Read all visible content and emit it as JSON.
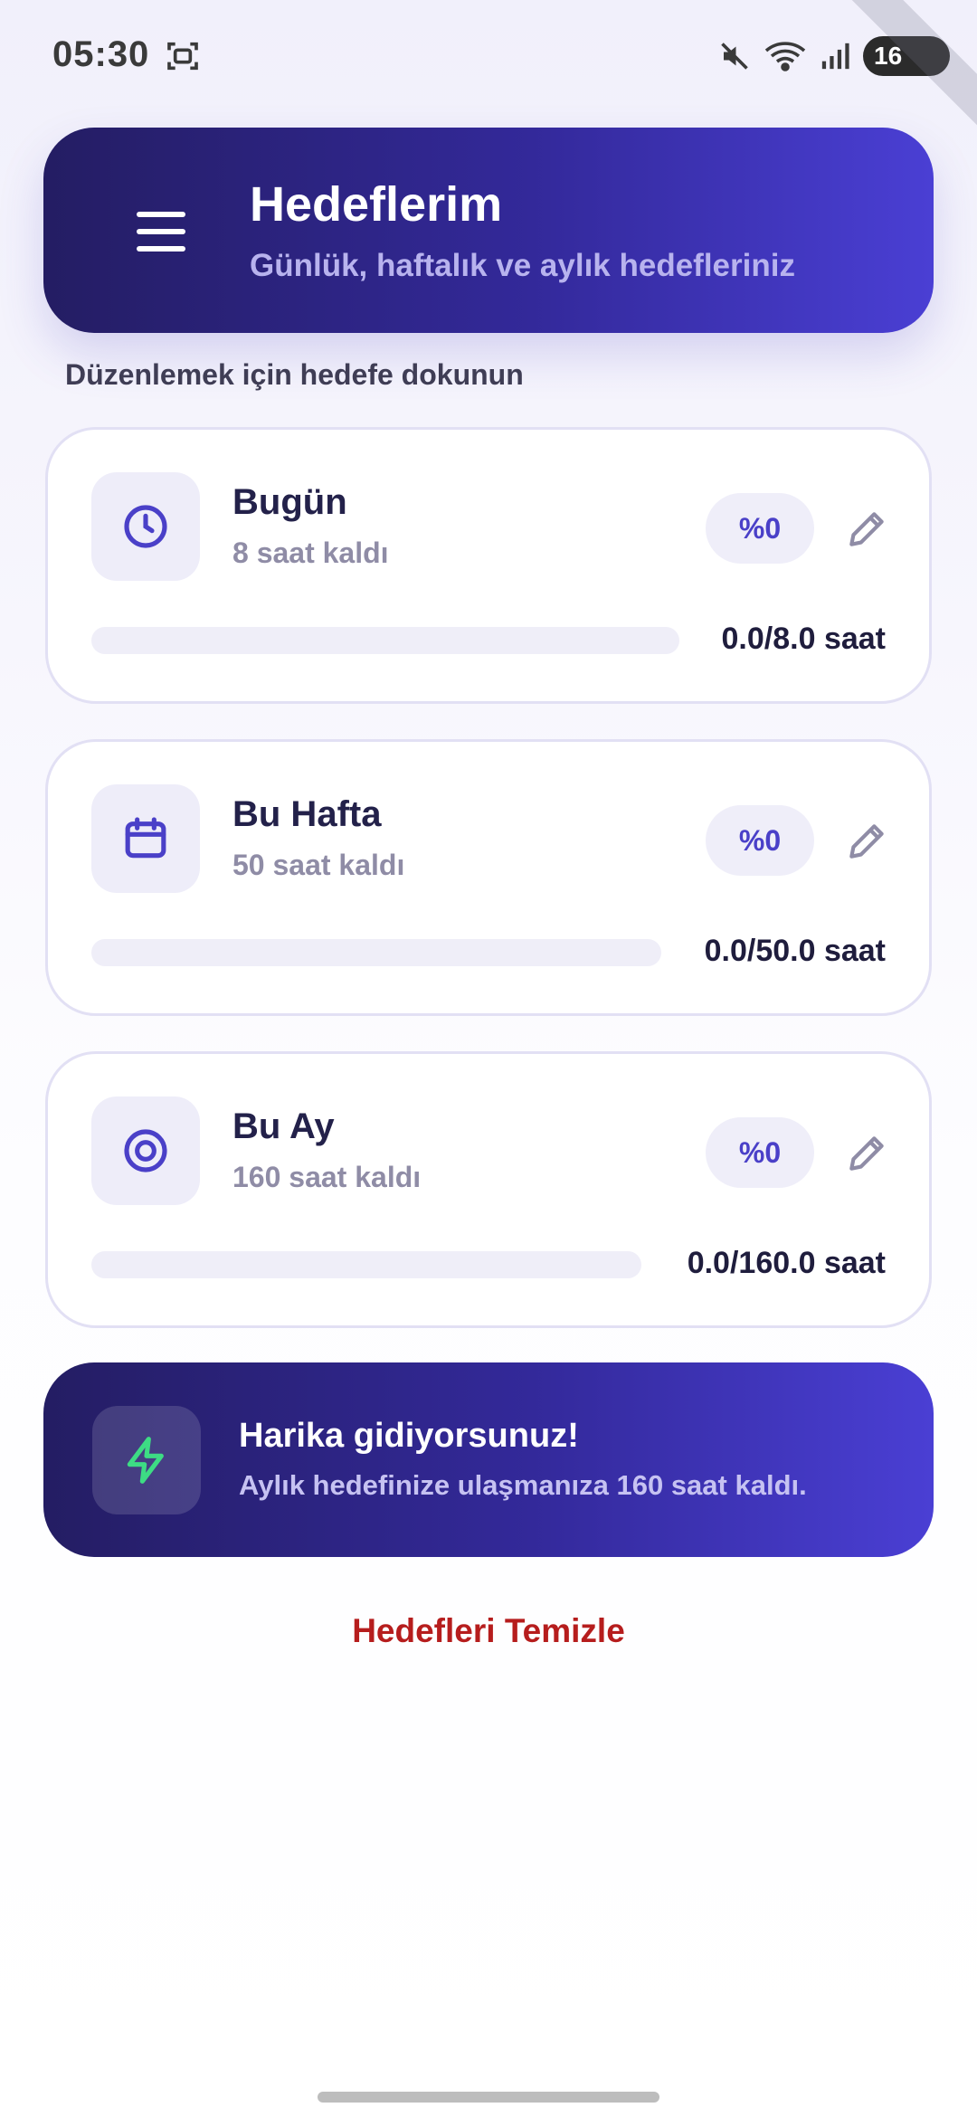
{
  "status_bar": {
    "time": "05:30",
    "battery": "16",
    "icons": [
      "screenshot-icon",
      "mute-icon",
      "wifi-icon",
      "signal-icon",
      "battery-icon"
    ]
  },
  "header": {
    "title": "Hedeflerim",
    "subtitle": "Günlük, haftalık ve aylık hedefleriniz",
    "menu_icon": "menu-icon"
  },
  "hint": "Düzenlemek için hedefe dokunun",
  "goals": [
    {
      "title": "Bugün",
      "remaining": "8 saat kaldı",
      "percent_label": "%0",
      "percent": 0,
      "progress_label": "0.0/8.0 saat",
      "icon": "clock-icon"
    },
    {
      "title": "Bu Hafta",
      "remaining": "50 saat kaldı",
      "percent_label": "%0",
      "percent": 0,
      "progress_label": "0.0/50.0 saat",
      "icon": "calendar-icon"
    },
    {
      "title": "Bu Ay",
      "remaining": "160 saat kaldı",
      "percent_label": "%0",
      "percent": 0,
      "progress_label": "0.0/160.0 saat",
      "icon": "target-icon"
    }
  ],
  "motivation": {
    "title": "Harika gidiyorsunuz!",
    "text": "Aylık hedefinize ulaşmanıza 160 saat kaldı.",
    "icon": "bolt-icon"
  },
  "clear_button": "Hedefleri Temizle",
  "colors": {
    "accent": "#4a40c8",
    "header_gradient_start": "#241d63",
    "header_gradient_end": "#4a3fd4",
    "danger": "#b61d1d",
    "bolt": "#3ddc84"
  }
}
